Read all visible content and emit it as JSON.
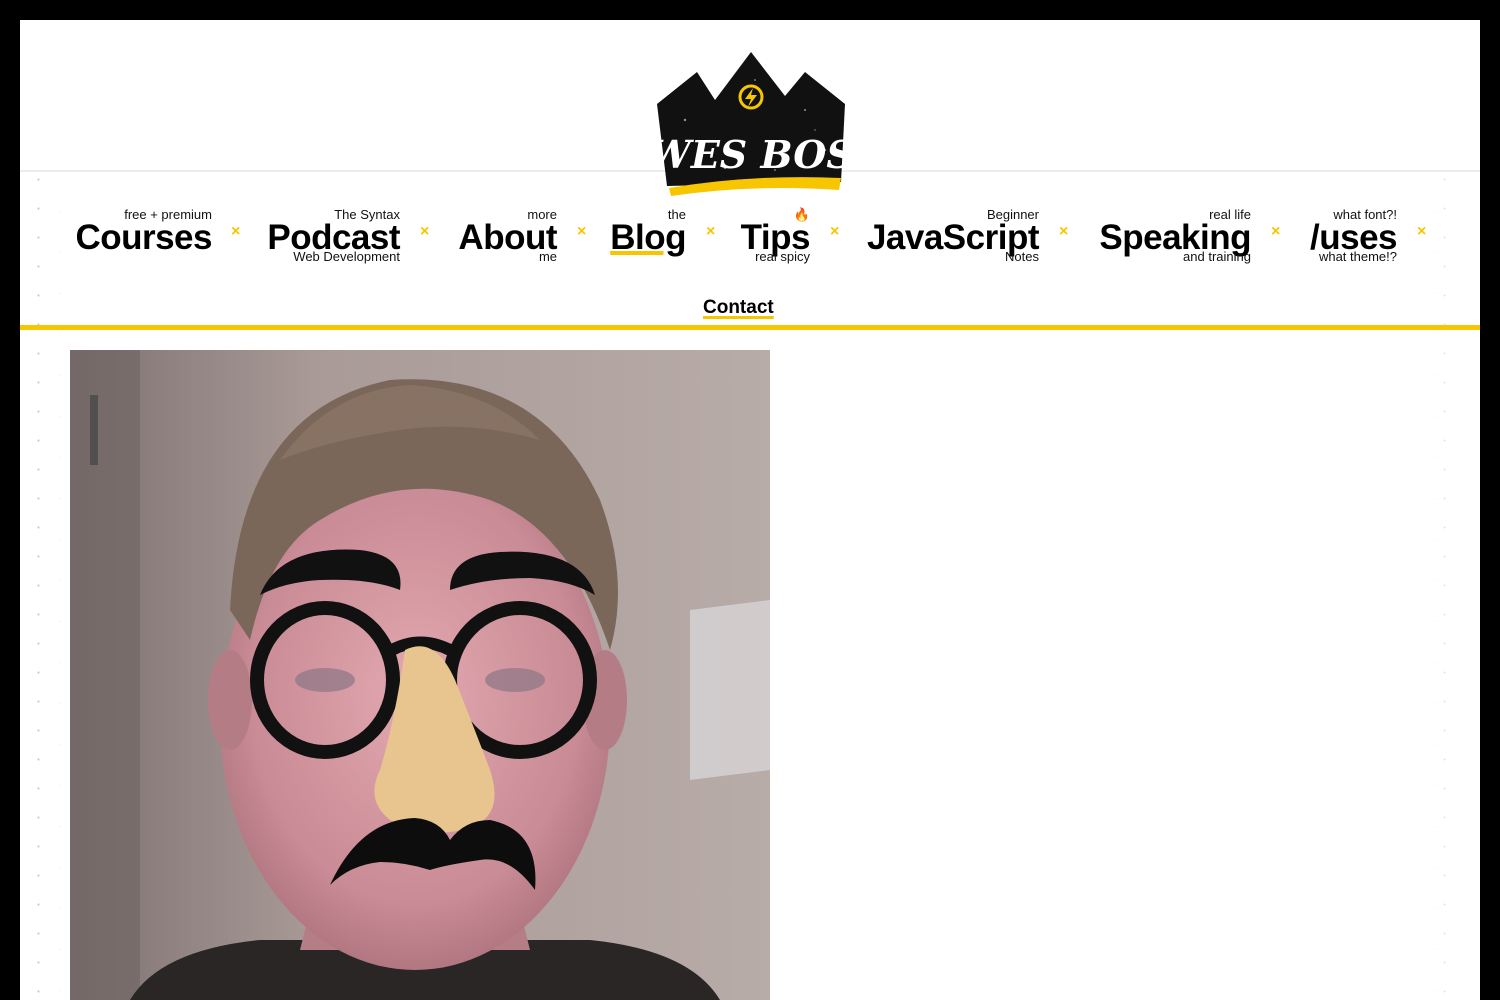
{
  "logo": {
    "text": "WES BOS"
  },
  "nav": {
    "items": [
      {
        "top": "free + premium",
        "main": "Courses",
        "bottom": ""
      },
      {
        "top": "The Syntax",
        "main": "Podcast",
        "bottom": "Web Development"
      },
      {
        "top": "more",
        "main": "About",
        "bottom": "me"
      },
      {
        "top": "the",
        "main": "Blog",
        "bottom": ""
      },
      {
        "top": "🔥",
        "main": "Tips",
        "bottom": "real spicy"
      },
      {
        "top": "Beginner",
        "main": "JavaScript",
        "bottom": "Notes"
      },
      {
        "top": "real life",
        "main": "Speaking",
        "bottom": "and training"
      },
      {
        "top": "what font?!",
        "main": "/uses",
        "bottom": "what theme!?"
      }
    ],
    "separator": "×",
    "contact": "Contact"
  },
  "colors": {
    "accent": "#f7c600",
    "frame": "#000000",
    "text": "#000000"
  },
  "photo": {
    "description_icon": "webcam-photo-with-groucho-glasses-filter"
  }
}
